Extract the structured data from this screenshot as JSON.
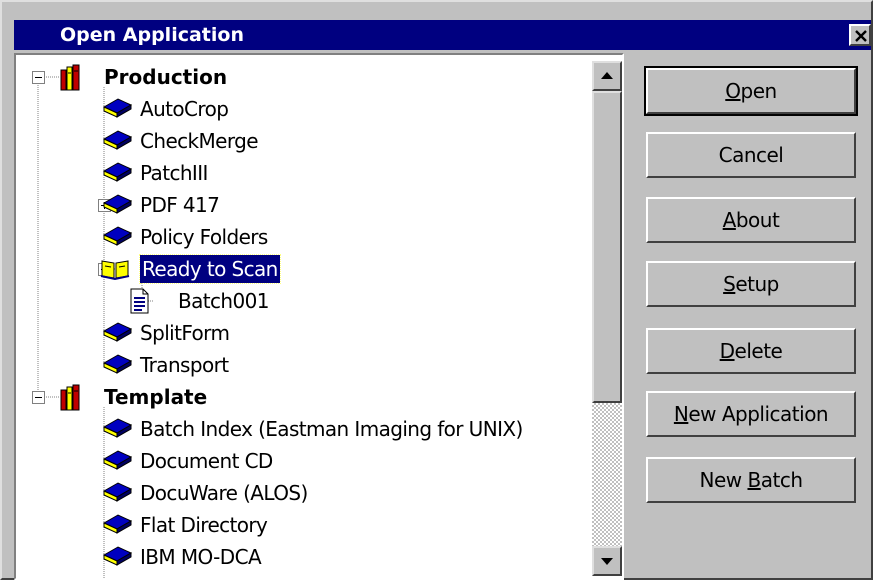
{
  "window": {
    "title": "Open Application"
  },
  "tree": [
    {
      "label": "Production",
      "type": "root",
      "expander": "minus",
      "icon": "books-icon"
    },
    {
      "label": "AutoCrop",
      "type": "app",
      "icon": "book-icon"
    },
    {
      "label": "CheckMerge",
      "type": "app",
      "icon": "book-icon"
    },
    {
      "label": "PatchIII",
      "type": "app",
      "icon": "book-icon"
    },
    {
      "label": "PDF 417",
      "type": "app",
      "expander": "plus",
      "icon": "book-icon"
    },
    {
      "label": "Policy Folders",
      "type": "app",
      "icon": "book-icon"
    },
    {
      "label": "Ready to Scan",
      "type": "app",
      "expander": "minus",
      "icon": "open-book-icon",
      "selected": true
    },
    {
      "label": "Batch001",
      "type": "batch",
      "icon": "document-icon"
    },
    {
      "label": "SplitForm",
      "type": "app",
      "icon": "book-icon"
    },
    {
      "label": "Transport",
      "type": "app",
      "icon": "book-icon"
    },
    {
      "label": "Template",
      "type": "root",
      "expander": "minus",
      "icon": "books-icon"
    },
    {
      "label": "Batch Index (Eastman Imaging for UNIX)",
      "type": "app",
      "icon": "book-icon"
    },
    {
      "label": "Document CD",
      "type": "app",
      "icon": "book-icon"
    },
    {
      "label": "DocuWare (ALOS)",
      "type": "app",
      "icon": "book-icon"
    },
    {
      "label": "Flat Directory",
      "type": "app",
      "icon": "book-icon"
    },
    {
      "label": "IBM MO-DCA",
      "type": "app",
      "icon": "book-icon"
    }
  ],
  "buttons": {
    "open": {
      "pre": "",
      "key": "O",
      "post": "pen"
    },
    "cancel": {
      "pre": "Cancel",
      "key": "",
      "post": ""
    },
    "about": {
      "pre": "",
      "key": "A",
      "post": "bout"
    },
    "setup": {
      "pre": "",
      "key": "S",
      "post": "etup"
    },
    "delete": {
      "pre": "",
      "key": "D",
      "post": "elete"
    },
    "new_application": {
      "pre": "",
      "key": "N",
      "post": "ew Application"
    },
    "new_batch": {
      "pre": "New ",
      "key": "B",
      "post": "atch"
    }
  },
  "colors": {
    "titlebar": "#000080",
    "selection": "#000080",
    "face": "#c0c0c0",
    "book_blue": "#0000c0",
    "book_pages": "#ffff00"
  }
}
